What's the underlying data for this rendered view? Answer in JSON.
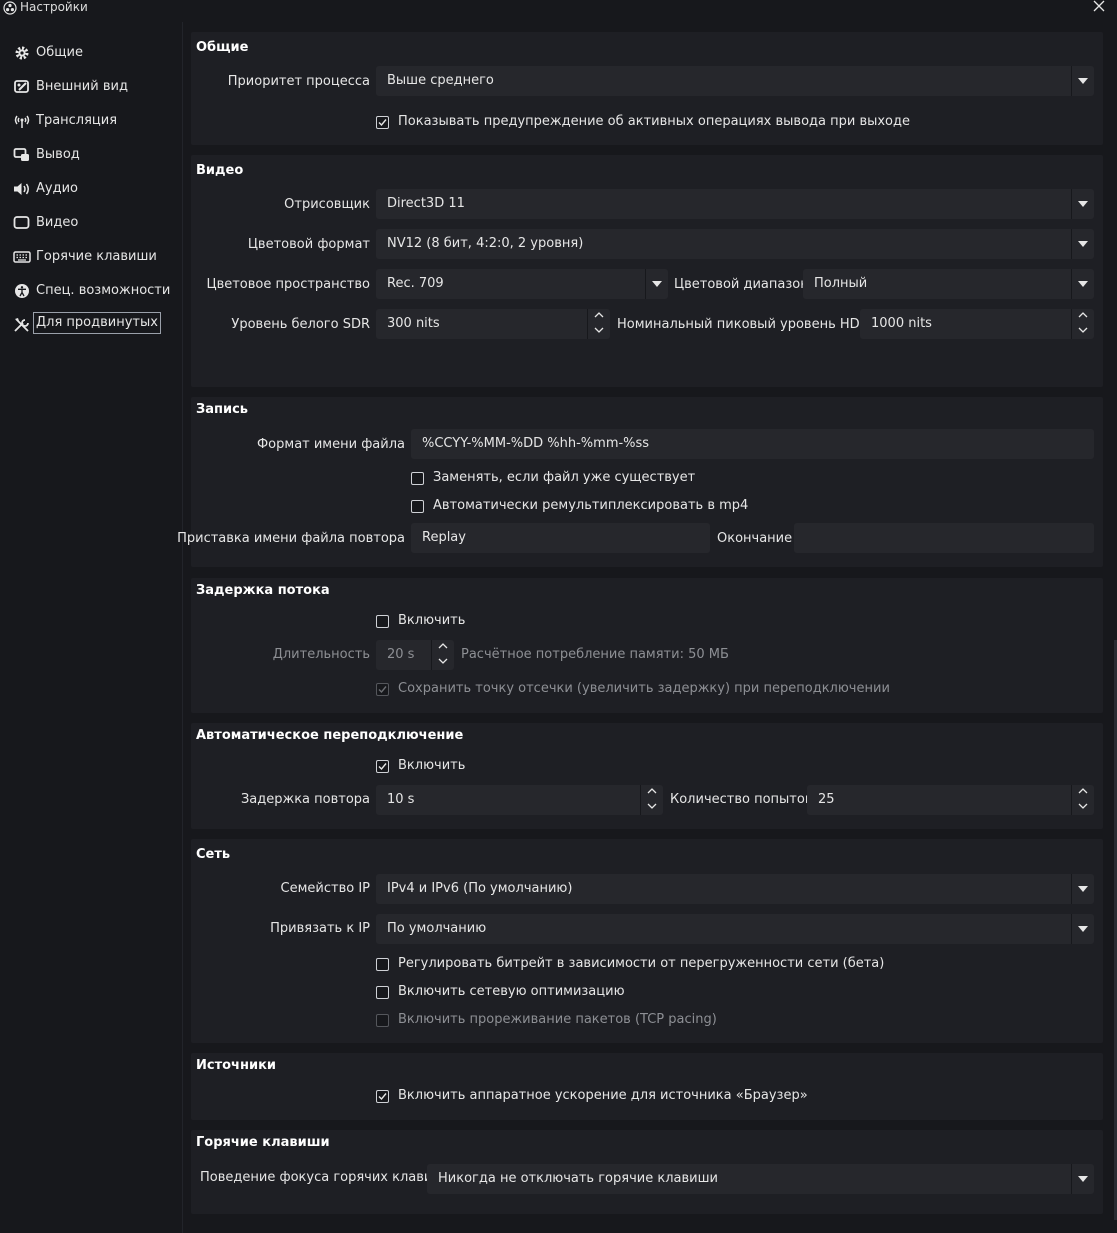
{
  "window": {
    "title": "Настройки"
  },
  "sidebar": {
    "items": [
      {
        "label": "Общие",
        "icon": "gear-icon"
      },
      {
        "label": "Внешний вид",
        "icon": "appearance-icon"
      },
      {
        "label": "Трансляция",
        "icon": "broadcast-icon"
      },
      {
        "label": "Вывод",
        "icon": "output-icon"
      },
      {
        "label": "Аудио",
        "icon": "speaker-icon"
      },
      {
        "label": "Видео",
        "icon": "monitor-icon"
      },
      {
        "label": "Горячие клавиши",
        "icon": "keyboard-icon"
      },
      {
        "label": "Спец. возможности",
        "icon": "accessibility-icon"
      },
      {
        "label": "Для продвинутых",
        "icon": "tools-icon",
        "selected": true
      }
    ]
  },
  "general": {
    "title": "Общие",
    "priority_label": "Приоритет процесса",
    "priority_value": "Выше среднего",
    "warn_exit_label": "Показывать предупреждение об активных операциях вывода при выходе",
    "warn_exit_checked": true
  },
  "video": {
    "title": "Видео",
    "renderer_label": "Отрисовщик",
    "renderer_value": "Direct3D 11",
    "color_format_label": "Цветовой формат",
    "color_format_value": "NV12 (8 бит, 4:2:0, 2 уровня)",
    "color_space_label": "Цветовое пространство",
    "color_space_value": "Rec. 709",
    "color_range_label": "Цветовой диапазон",
    "color_range_value": "Полный",
    "sdr_white_label": "Уровень белого SDR",
    "sdr_white_value": "300 nits",
    "hdr_peak_label": "Номинальный пиковый уровень HDR",
    "hdr_peak_value": "1000 nits"
  },
  "recording": {
    "title": "Запись",
    "filename_format_label": "Формат имени файла",
    "filename_format_value": "%CCYY-%MM-%DD %hh-%mm-%ss",
    "overwrite_label": "Заменять, если файл уже существует",
    "overwrite_checked": false,
    "remux_label": "Автоматически ремультиплексировать в mp4",
    "remux_checked": false,
    "replay_prefix_label": "Приставка имени файла повтора",
    "replay_prefix_value": "Replay",
    "suffix_label": "Окончание",
    "suffix_value": ""
  },
  "stream_delay": {
    "title": "Задержка потока",
    "enable_label": "Включить",
    "enable_checked": false,
    "duration_label": "Длительность",
    "duration_value": "20 s",
    "memory_text": "Расчётное потребление памяти: 50 МБ",
    "preserve_label": "Сохранить точку отсечки (увеличить задержку) при переподключении",
    "preserve_checked": true
  },
  "reconnect": {
    "title": "Автоматическое переподключение",
    "enable_label": "Включить",
    "enable_checked": true,
    "retry_delay_label": "Задержка повтора",
    "retry_delay_value": "10 s",
    "max_retries_label": "Количество попыток",
    "max_retries_value": "25"
  },
  "network": {
    "title": "Сеть",
    "ip_family_label": "Семейство IP",
    "ip_family_value": "IPv4 и IPv6 (По умолчанию)",
    "bind_ip_label": "Привязать к IP",
    "bind_ip_value": "По умолчанию",
    "dyn_bitrate_label": "Регулировать битрейт в зависимости от перегруженности сети (бета)",
    "dyn_bitrate_checked": false,
    "net_opt_label": "Включить сетевую оптимизацию",
    "net_opt_checked": false,
    "tcp_pacing_label": "Включить прореживание пакетов (TCP pacing)",
    "tcp_pacing_checked": false
  },
  "sources": {
    "title": "Источники",
    "browser_hw_label": "Включить аппаратное ускорение для источника «Браузер»",
    "browser_hw_checked": true
  },
  "hotkeys": {
    "title": "Горячие клавиши",
    "focus_label": "Поведение фокуса горячих клавиш",
    "focus_value": "Никогда не отключать горячие клавиши"
  },
  "colors": {
    "background": "#17181c",
    "group_background": "#1e1f24",
    "field_background": "#26272c",
    "text": "#e6e6e6",
    "disabled_text": "#8d8f94"
  }
}
